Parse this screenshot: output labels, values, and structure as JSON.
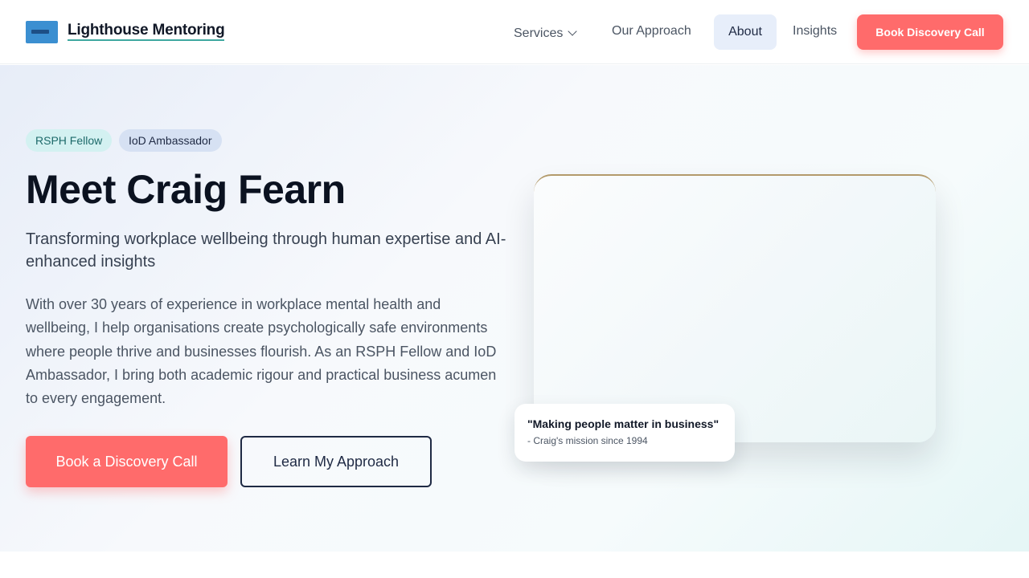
{
  "header": {
    "brand": "Lighthouse Mentoring",
    "logo_icon": "lighthouse-logo-icon",
    "nav": {
      "services": "Services",
      "approach": "Our Approach",
      "about": "About",
      "insights": "Insights"
    },
    "cta": "Book Discovery Call"
  },
  "hero": {
    "badges": [
      "RSPH Fellow",
      "IoD Ambassador"
    ],
    "title": "Meet Craig Fearn",
    "subtitle": "Transforming workplace wellbeing through human expertise and AI-enhanced insights",
    "body": "With over 30 years of experience in workplace mental health and wellbeing, I help organisations create psychologically safe environments where people thrive and businesses flourish. As an RSPH Fellow and IoD Ambassador, I bring both academic rigour and practical business acumen to every engagement.",
    "primary_button": "Book a Discovery Call",
    "secondary_button": "Learn My Approach",
    "quote": {
      "text": "\"Making people matter in business\"",
      "attribution": "- Craig's mission since 1994"
    }
  },
  "colors": {
    "accent": "#ff6b6b",
    "navy": "#1f2a44",
    "teal_badge": "#d3f1f1",
    "blue_badge": "#d6e1f3"
  }
}
